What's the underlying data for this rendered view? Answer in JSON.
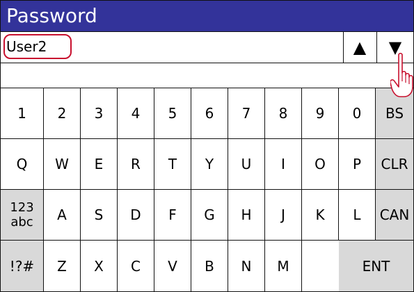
{
  "title": "Password",
  "user": {
    "value": "User2"
  },
  "nav": {
    "up_label": "▲",
    "down_label": "▼"
  },
  "colors": {
    "titlebar": "#33339a",
    "highlight": "#c8102e",
    "special_key": "#d9d9d9"
  },
  "icons": {
    "pointer": "pointing-hand-icon"
  },
  "keyboard": {
    "row1": [
      "1",
      "2",
      "3",
      "4",
      "5",
      "6",
      "7",
      "8",
      "9",
      "0",
      "BS"
    ],
    "row2": [
      "Q",
      "W",
      "E",
      "R",
      "T",
      "Y",
      "U",
      "I",
      "O",
      "P",
      "CLR"
    ],
    "row3": [
      "123\nabc",
      "A",
      "S",
      "D",
      "F",
      "G",
      "H",
      "J",
      "K",
      "L",
      "CAN"
    ],
    "row4": [
      "!?#",
      "Z",
      "X",
      "C",
      "V",
      "B",
      "N",
      "M",
      "ENT"
    ]
  }
}
